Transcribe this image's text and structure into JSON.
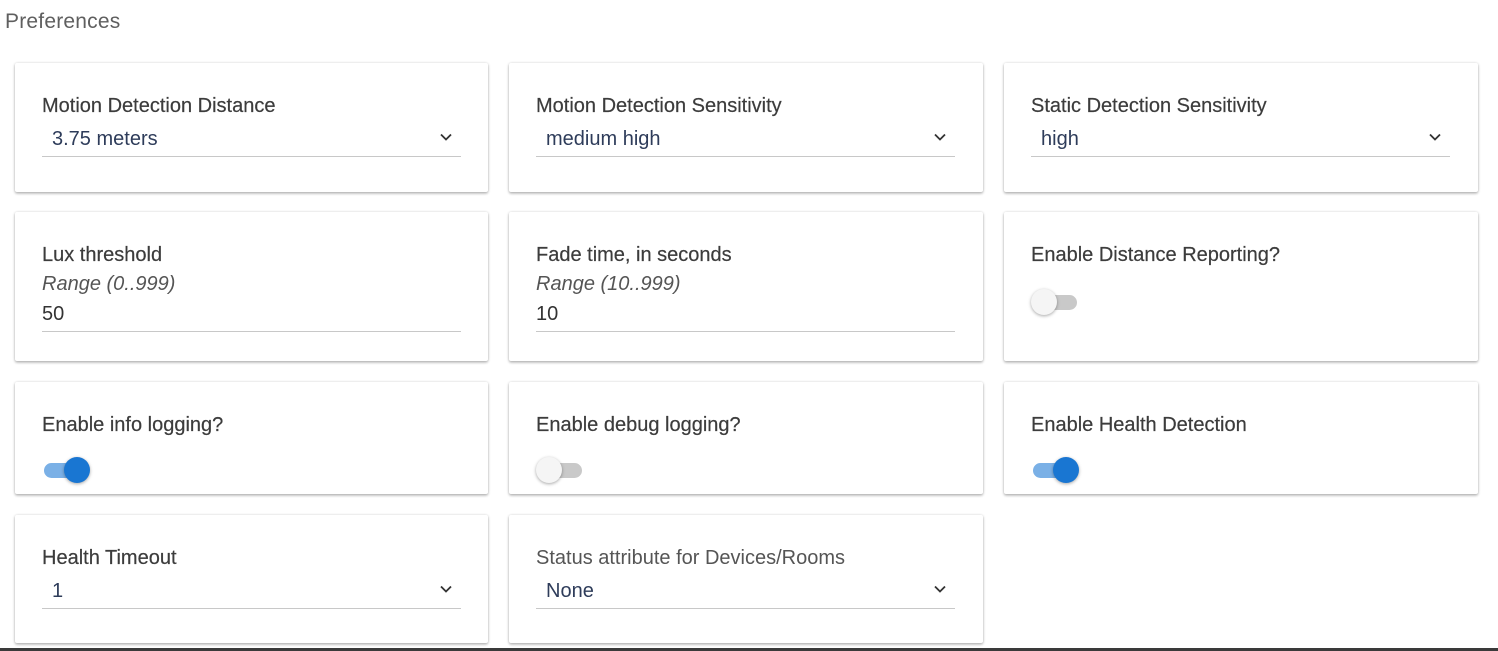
{
  "page": {
    "title": "Preferences"
  },
  "prefs": {
    "motion_distance": {
      "label": "Motion Detection Distance",
      "value": "3.75 meters",
      "icon": "chevron-down-icon"
    },
    "motion_sensitivity": {
      "label": "Motion Detection Sensitivity",
      "value": "medium high",
      "icon": "chevron-down-icon"
    },
    "static_sensitivity": {
      "label": "Static Detection Sensitivity",
      "value": "high",
      "icon": "chevron-down-icon"
    },
    "lux_threshold": {
      "label": "Lux threshold",
      "hint": "Range (0..999)",
      "value": "50"
    },
    "fade_time": {
      "label": "Fade time, in seconds",
      "hint": "Range (10..999)",
      "value": "10"
    },
    "distance_reporting": {
      "label": "Enable Distance Reporting?",
      "enabled": false
    },
    "info_logging": {
      "label": "Enable info logging?",
      "enabled": true
    },
    "debug_logging": {
      "label": "Enable debug logging?",
      "enabled": false
    },
    "health_detection": {
      "label": "Enable Health Detection",
      "enabled": true
    },
    "health_timeout": {
      "label": "Health Timeout",
      "value": "1",
      "icon": "chevron-down-icon"
    },
    "status_attribute": {
      "label": "Status attribute for Devices/Rooms",
      "value": "None",
      "icon": "chevron-down-icon"
    }
  },
  "colors": {
    "accent": "#1976d2",
    "accent_track": "#7ab0e6",
    "off_track": "#c9c9c9",
    "select_text": "#2e3c5a"
  }
}
